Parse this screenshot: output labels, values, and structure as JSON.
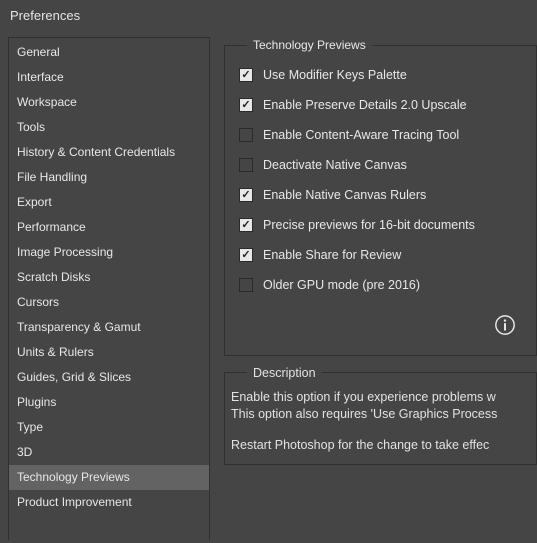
{
  "window": {
    "title": "Preferences"
  },
  "sidebar": {
    "items": [
      {
        "label": "General",
        "selected": false
      },
      {
        "label": "Interface",
        "selected": false
      },
      {
        "label": "Workspace",
        "selected": false
      },
      {
        "label": "Tools",
        "selected": false
      },
      {
        "label": "History & Content Credentials",
        "selected": false
      },
      {
        "label": "File Handling",
        "selected": false
      },
      {
        "label": "Export",
        "selected": false
      },
      {
        "label": "Performance",
        "selected": false
      },
      {
        "label": "Image Processing",
        "selected": false
      },
      {
        "label": "Scratch Disks",
        "selected": false
      },
      {
        "label": "Cursors",
        "selected": false
      },
      {
        "label": "Transparency & Gamut",
        "selected": false
      },
      {
        "label": "Units & Rulers",
        "selected": false
      },
      {
        "label": "Guides, Grid & Slices",
        "selected": false
      },
      {
        "label": "Plugins",
        "selected": false
      },
      {
        "label": "Type",
        "selected": false
      },
      {
        "label": "3D",
        "selected": false
      },
      {
        "label": "Technology Previews",
        "selected": true
      },
      {
        "label": "Product Improvement",
        "selected": false
      }
    ]
  },
  "group": {
    "title": "Technology Previews",
    "checkboxes": [
      {
        "label": "Use Modifier Keys Palette",
        "checked": true
      },
      {
        "label": "Enable Preserve Details 2.0 Upscale",
        "checked": true
      },
      {
        "label": "Enable Content-Aware Tracing Tool",
        "checked": false
      },
      {
        "label": "Deactivate Native Canvas",
        "checked": false
      },
      {
        "label": "Enable Native Canvas Rulers",
        "checked": true
      },
      {
        "label": "Precise previews for 16-bit documents",
        "checked": true
      },
      {
        "label": "Enable Share for Review",
        "checked": true
      },
      {
        "label": "Older GPU mode (pre 2016)",
        "checked": false
      }
    ]
  },
  "description": {
    "title": "Description",
    "line1": "Enable this option if you experience problems w",
    "line2": "This option also requires 'Use Graphics Process",
    "line3": "Restart Photoshop for the change to take effec"
  }
}
